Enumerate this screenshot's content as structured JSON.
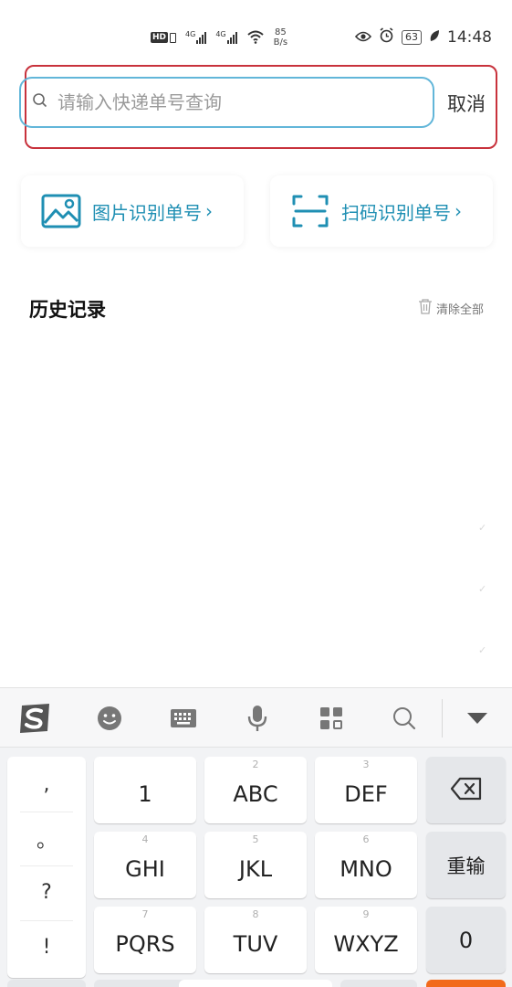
{
  "status_bar": {
    "hd": "HD",
    "network_1": "4G",
    "network_2": "4G",
    "speed_value": "85",
    "speed_unit": "B/s",
    "battery": "63",
    "time": "14:48"
  },
  "search": {
    "placeholder": "请输入快递单号查询",
    "cancel_label": "取消"
  },
  "actions": {
    "image_recognize_label": "图片识别单号",
    "scan_recognize_label": "扫码识别单号",
    "arrow": "›"
  },
  "history": {
    "title": "历史记录",
    "clear_label": "清除全部",
    "ghost_mark": "✓"
  },
  "keyboard": {
    "toolbar_icons": [
      "sogou-logo-icon",
      "emoji-icon",
      "keyboard-icon",
      "microphone-icon",
      "grid-apps-icon",
      "search-icon",
      "collapse-keyboard-icon"
    ],
    "punctuation": [
      ",",
      "。",
      "?",
      "!"
    ],
    "keys": [
      {
        "num": "",
        "label": "1"
      },
      {
        "num": "2",
        "label": "ABC"
      },
      {
        "num": "3",
        "label": "DEF"
      },
      {
        "num": "4",
        "label": "GHI"
      },
      {
        "num": "5",
        "label": "JKL"
      },
      {
        "num": "6",
        "label": "MNO"
      },
      {
        "num": "7",
        "label": "PQRS"
      },
      {
        "num": "8",
        "label": "TUV"
      },
      {
        "num": "9",
        "label": "WXYZ"
      }
    ],
    "reset_label": "重输",
    "zero_label": "0"
  },
  "colors": {
    "accent": "#1f8fb3",
    "search_border": "#62b6d9",
    "highlight_border": "#c8323c",
    "sogou_orange": "#f26a1b"
  }
}
